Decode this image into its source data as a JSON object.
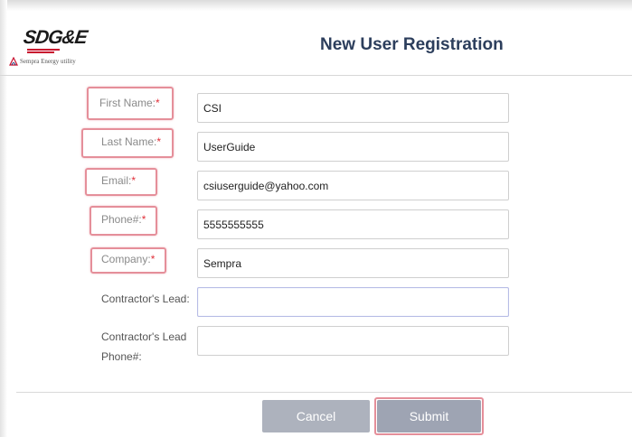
{
  "header": {
    "logo_text": "SDG&E",
    "logo_sub": "Sempra Energy utility",
    "title": "New User Registration"
  },
  "form": {
    "required_mark": "*",
    "fields": [
      {
        "label": "First Name:",
        "value": "CSI",
        "required": true
      },
      {
        "label": "Last Name:",
        "value": "UserGuide",
        "required": true
      },
      {
        "label": "Email:",
        "value": "csiuserguide@yahoo.com",
        "required": true
      },
      {
        "label": "Phone#:",
        "value": "5555555555",
        "required": true
      },
      {
        "label": "Company:",
        "value": "Sempra",
        "required": true
      },
      {
        "label": "Contractor's Lead:",
        "value": "",
        "required": false
      },
      {
        "label_line1": "Contractor's Lead",
        "label_line2": "Phone#:",
        "value": "",
        "required": false
      }
    ]
  },
  "buttons": {
    "cancel": "Cancel",
    "submit": "Submit"
  },
  "colors": {
    "title": "#2c3e5c",
    "required": "#e0303a",
    "highlight": "#e58f9a",
    "button": "#adb2bd",
    "brand_red": "#c8102e"
  },
  "icons": {
    "sempra_logo": "sempra-flame-icon"
  }
}
